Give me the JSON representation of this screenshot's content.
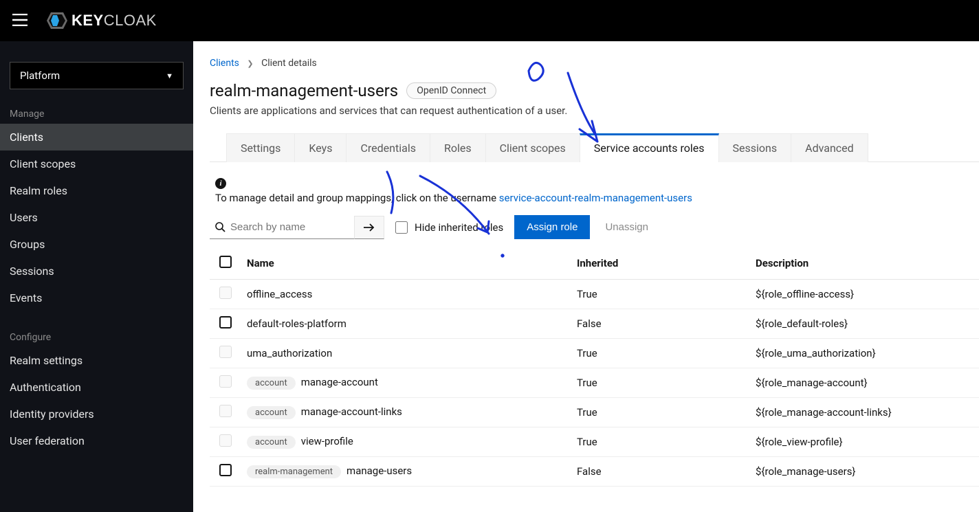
{
  "brand": {
    "text1": "KEY",
    "text2": "CLOAK"
  },
  "realm": {
    "selected": "Platform"
  },
  "sidebar": {
    "sections": [
      {
        "title": "Manage",
        "items": [
          {
            "label": "Clients",
            "active": true
          },
          {
            "label": "Client scopes"
          },
          {
            "label": "Realm roles"
          },
          {
            "label": "Users"
          },
          {
            "label": "Groups"
          },
          {
            "label": "Sessions"
          },
          {
            "label": "Events"
          }
        ]
      },
      {
        "title": "Configure",
        "items": [
          {
            "label": "Realm settings"
          },
          {
            "label": "Authentication"
          },
          {
            "label": "Identity providers"
          },
          {
            "label": "User federation"
          }
        ]
      }
    ]
  },
  "breadcrumb": {
    "parent": "Clients",
    "current": "Client details"
  },
  "page": {
    "title": "realm-management-users",
    "protocol": "OpenID Connect",
    "description": "Clients are applications and services that can request authentication of a user."
  },
  "tabs": [
    {
      "label": "Settings"
    },
    {
      "label": "Keys"
    },
    {
      "label": "Credentials"
    },
    {
      "label": "Roles"
    },
    {
      "label": "Client scopes"
    },
    {
      "label": "Service accounts roles",
      "active": true
    },
    {
      "label": "Sessions"
    },
    {
      "label": "Advanced"
    }
  ],
  "info": {
    "text": "To manage detail and group mappings, click on the username ",
    "link": "service-account-realm-management-users"
  },
  "toolbar": {
    "searchPlaceholder": "Search by name",
    "hideInherited": "Hide inherited roles",
    "assign": "Assign role",
    "unassign": "Unassign"
  },
  "table": {
    "headers": {
      "name": "Name",
      "inherited": "Inherited",
      "description": "Description"
    },
    "rows": [
      {
        "checkable": false,
        "chip": null,
        "name": "offline_access",
        "inherited": "True",
        "description": "${role_offline-access}"
      },
      {
        "checkable": true,
        "chip": null,
        "name": "default-roles-platform",
        "inherited": "False",
        "description": "${role_default-roles}"
      },
      {
        "checkable": false,
        "chip": null,
        "name": "uma_authorization",
        "inherited": "True",
        "description": "${role_uma_authorization}"
      },
      {
        "checkable": false,
        "chip": "account",
        "name": "manage-account",
        "inherited": "True",
        "description": "${role_manage-account}"
      },
      {
        "checkable": false,
        "chip": "account",
        "name": "manage-account-links",
        "inherited": "True",
        "description": "${role_manage-account-links}"
      },
      {
        "checkable": false,
        "chip": "account",
        "name": "view-profile",
        "inherited": "True",
        "description": "${role_view-profile}"
      },
      {
        "checkable": true,
        "chip": "realm-management",
        "name": "manage-users",
        "inherited": "False",
        "description": "${role_manage-users}"
      }
    ]
  }
}
